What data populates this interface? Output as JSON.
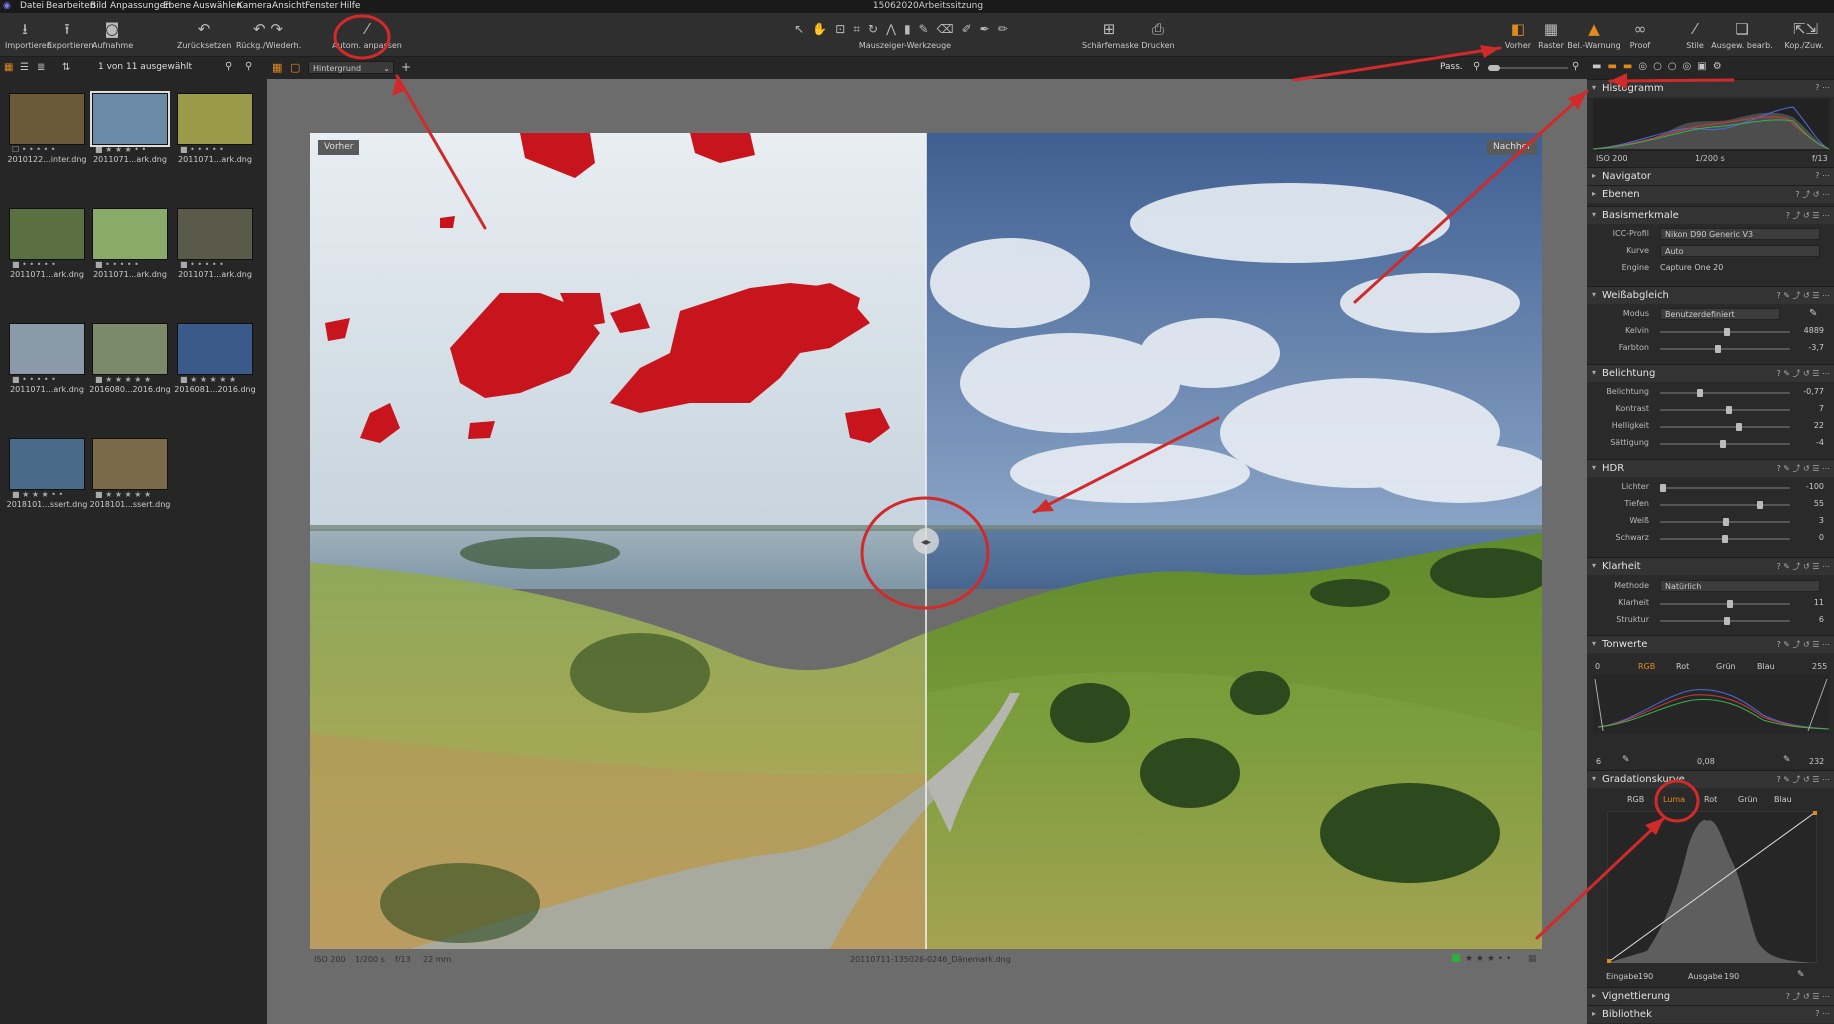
{
  "menu": [
    "Datei",
    "Bearbeiten",
    "Bild",
    "Anpassungen",
    "Ebene",
    "Auswählen",
    "Kamera",
    "Ansicht",
    "Fenster",
    "Hilfe"
  ],
  "app_title": "15062020Arbeitssitzung",
  "toolbar": {
    "import": "Importieren",
    "export": "Exportieren",
    "capture": "Aufnahme",
    "reset": "Zurücksetzen",
    "undo_redo": "Rückg./Wiederh.",
    "auto_adjust": "Autom. anpassen",
    "cursor_tools": "Mauszeiger-Werkzeuge",
    "focus_mask": "Schärfemaske",
    "print": "Drucken",
    "before": "Vorher",
    "grid": "Raster",
    "exposure_warning": "Bel.-Warnung",
    "proof": "Proof",
    "styles": "Stile",
    "edit_selected": "Ausgew. bearb.",
    "copy_apply": "Kop./Zuw."
  },
  "bar2": {
    "selected_count": "1 von 11 ausgewählt",
    "layer_select": "Hintergrund",
    "fit": "Pass."
  },
  "thumbnails": [
    {
      "cap": "2010122...inter.dng",
      "stars": "☐ • • • • •",
      "color": "#6a5a3a"
    },
    {
      "cap": "2011071...ark.dng",
      "stars": "■ ★ ★ ★ • •",
      "color": "#6b8aa8"
    },
    {
      "cap": "2011071...ark.dng",
      "stars": "■ • • • • •",
      "color": "#9a9a4a"
    },
    {
      "cap": "2011071...ark.dng",
      "stars": "■ • • • • •",
      "color": "#5a7040"
    },
    {
      "cap": "2011071...ark.dng",
      "stars": "■ • • • • •",
      "color": "#8aaa6a"
    },
    {
      "cap": "2011071...ark.dng",
      "stars": "■ • • • • •",
      "color": "#5a5a4a"
    },
    {
      "cap": "2011071...ark.dng",
      "stars": "■ • • • • •",
      "color": "#8a9aa8"
    },
    {
      "cap": "2016080...2016.dng",
      "stars": "■ ★ ★ ★ ★ ★",
      "color": "#7a8a6a"
    },
    {
      "cap": "2016081...2016.dng",
      "stars": "■ ★ ★ ★ ★ ★",
      "color": "#3a5a8a"
    },
    {
      "cap": "2018101...ssert.dng",
      "stars": "■ ★ ★ ★ • •",
      "color": "#4a6a8a"
    },
    {
      "cap": "2018101...ssert.dng",
      "stars": "■ ★ ★ ★ ★ ★",
      "color": "#7a6a4a"
    }
  ],
  "viewer": {
    "before_label": "Vorher",
    "after_label": "Nachher",
    "iso": "ISO 200",
    "shutter": "1/200 s",
    "aperture": "f/13",
    "focal": "22 mm",
    "filename": "20110711-135026-0246_Dänemark.dng",
    "rating": "★ ★ ★ • •"
  },
  "tools": {
    "histogram": {
      "title": "Histogramm",
      "iso": "ISO 200",
      "shutter": "1/200 s",
      "aperture": "f/13"
    },
    "navigator": "Navigator",
    "layers": "Ebenen",
    "base": {
      "title": "Basismerkmale",
      "icc_label": "ICC-Profil",
      "icc_value": "Nikon D90 Generic V3",
      "curve_label": "Kurve",
      "curve_value": "Auto",
      "engine_label": "Engine",
      "engine_value": "Capture One 20"
    },
    "wb": {
      "title": "Weißabgleich",
      "mode_label": "Modus",
      "mode_value": "Benutzerdefiniert",
      "kelvin_label": "Kelvin",
      "kelvin_value": "4889",
      "tint_label": "Farbton",
      "tint_value": "-3,7"
    },
    "exposure": {
      "title": "Belichtung",
      "rows": [
        {
          "label": "Belichtung",
          "value": "-0,77",
          "pos": 0.3
        },
        {
          "label": "Kontrast",
          "value": "7",
          "pos": 0.53
        },
        {
          "label": "Helligkeit",
          "value": "22",
          "pos": 0.61
        },
        {
          "label": "Sättigung",
          "value": "-4",
          "pos": 0.48
        }
      ]
    },
    "hdr": {
      "title": "HDR",
      "rows": [
        {
          "label": "Lichter",
          "value": "-100",
          "pos": 0.0
        },
        {
          "label": "Tiefen",
          "value": "55",
          "pos": 0.78
        },
        {
          "label": "Weiß",
          "value": "3",
          "pos": 0.51
        },
        {
          "label": "Schwarz",
          "value": "0",
          "pos": 0.5
        }
      ]
    },
    "clarity": {
      "title": "Klarheit",
      "method_label": "Methode",
      "method_value": "Natürlich",
      "rows": [
        {
          "label": "Klarheit",
          "value": "11",
          "pos": 0.54
        },
        {
          "label": "Struktur",
          "value": "6",
          "pos": 0.52
        }
      ]
    },
    "levels": {
      "title": "Tonwerte",
      "min": "0",
      "max": "255",
      "tabs": [
        "RGB",
        "Rot",
        "Grün",
        "Blau"
      ],
      "low": "6",
      "mid": "0,08",
      "high": "232"
    },
    "curve": {
      "title": "Gradationskurve",
      "tabs": [
        "RGB",
        "Luma",
        "Rot",
        "Grün",
        "Blau"
      ],
      "input_label": "Eingabe",
      "input_value": "190",
      "output_label": "Ausgabe",
      "output_value": "190"
    },
    "vignette": "Vignettierung",
    "library": "Bibliothek"
  },
  "colors": {
    "accent": "#e08a1e",
    "annotation": "#d02a2a",
    "mask": "#c8141c"
  }
}
